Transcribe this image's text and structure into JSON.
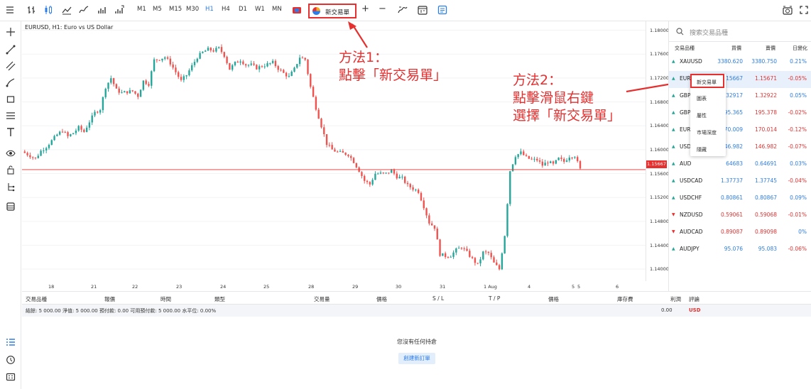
{
  "toolbar": {
    "timeframes": [
      "M1",
      "M5",
      "M15",
      "M30",
      "H1",
      "H4",
      "D1",
      "W1",
      "MN"
    ],
    "active_timeframe": "H1",
    "new_order_label": "新交易單",
    "plus_label": "+",
    "minus_label": "−"
  },
  "chart": {
    "title": "EURUSD, H1: Euro vs US Dollar",
    "current_price": "1.15667",
    "price_ticks": [
      "1.18000",
      "1.17600",
      "1.17200",
      "1.16800",
      "1.16400",
      "1.16000",
      "1.15600",
      "1.15200",
      "1.14800",
      "1.14400",
      "1.14000"
    ],
    "date_ticks": [
      "18",
      "21",
      "22",
      "23",
      "24",
      "25",
      "28",
      "29",
      "30",
      "31",
      "1 Aug",
      "4",
      "5",
      "5",
      "6"
    ],
    "colors": {
      "up": "#26a69a",
      "down": "#ef5350",
      "price_line": "#e5302f"
    }
  },
  "chart_data": {
    "type": "candlestick",
    "title": "EURUSD, H1: Euro vs US Dollar",
    "ylim": [
      1.138,
      1.1815
    ],
    "current_price": 1.15667,
    "x_labels": [
      "18",
      "21",
      "22",
      "23",
      "24",
      "25",
      "28",
      "29",
      "30",
      "31",
      "1 Aug",
      "4",
      "5",
      "5",
      "6"
    ],
    "close_path": [
      [
        0,
        1.1597
      ],
      [
        3,
        1.159
      ],
      [
        5,
        1.1585
      ],
      [
        7,
        1.1598
      ],
      [
        9,
        1.1605
      ],
      [
        11,
        1.1615
      ],
      [
        13,
        1.1625
      ],
      [
        15,
        1.1632
      ],
      [
        17,
        1.1622
      ],
      [
        19,
        1.1628
      ],
      [
        21,
        1.1637
      ],
      [
        23,
        1.163
      ],
      [
        25,
        1.1647
      ],
      [
        27,
        1.1662
      ],
      [
        29,
        1.1668
      ],
      [
        31,
        1.1705
      ],
      [
        33,
        1.172
      ],
      [
        35,
        1.17
      ],
      [
        37,
        1.1695
      ],
      [
        39,
        1.1697
      ],
      [
        41,
        1.1698
      ],
      [
        43,
        1.169
      ],
      [
        45,
        1.1715
      ],
      [
        47,
        1.171
      ],
      [
        49,
        1.175
      ],
      [
        51,
        1.1752
      ],
      [
        53,
        1.1755
      ],
      [
        55,
        1.1745
      ],
      [
        57,
        1.173
      ],
      [
        59,
        1.1715
      ],
      [
        61,
        1.1725
      ],
      [
        63,
        1.174
      ],
      [
        65,
        1.1755
      ],
      [
        67,
        1.1763
      ],
      [
        69,
        1.1768
      ],
      [
        71,
        1.1766
      ],
      [
        73,
        1.177
      ],
      [
        75,
        1.1758
      ],
      [
        77,
        1.1735
      ],
      [
        79,
        1.1745
      ],
      [
        81,
        1.175
      ],
      [
        83,
        1.1742
      ],
      [
        85,
        1.1742
      ],
      [
        87,
        1.1737
      ],
      [
        89,
        1.174
      ],
      [
        91,
        1.1743
      ],
      [
        93,
        1.1746
      ],
      [
        95,
        1.1736
      ],
      [
        97,
        1.1728
      ],
      [
        99,
        1.1722
      ],
      [
        101,
        1.1735
      ],
      [
        103,
        1.1755
      ],
      [
        105,
        1.1751
      ],
      [
        107,
        1.1705
      ],
      [
        109,
        1.167
      ],
      [
        111,
        1.164
      ],
      [
        113,
        1.161
      ],
      [
        115,
        1.16
      ],
      [
        117,
        1.1596
      ],
      [
        119,
        1.1594
      ],
      [
        121,
        1.1592
      ],
      [
        123,
        1.158
      ],
      [
        125,
        1.1565
      ],
      [
        127,
        1.1548
      ],
      [
        129,
        1.1542
      ],
      [
        131,
        1.156
      ],
      [
        133,
        1.156
      ],
      [
        135,
        1.156
      ],
      [
        137,
        1.1565
      ],
      [
        139,
        1.1555
      ],
      [
        141,
        1.1552
      ],
      [
        143,
        1.154
      ],
      [
        145,
        1.1535
      ],
      [
        147,
        1.153
      ],
      [
        149,
        1.1505
      ],
      [
        151,
        1.1478
      ],
      [
        153,
        1.147
      ],
      [
        155,
        1.1425
      ],
      [
        157,
        1.1422
      ],
      [
        159,
        1.1423
      ],
      [
        161,
        1.1432
      ],
      [
        163,
        1.1437
      ],
      [
        165,
        1.1428
      ],
      [
        167,
        1.1417
      ],
      [
        169,
        1.1407
      ],
      [
        171,
        1.1428
      ],
      [
        173,
        1.1427
      ],
      [
        175,
        1.141
      ],
      [
        177,
        1.14
      ],
      [
        179,
        1.1457
      ],
      [
        181,
        1.1565
      ],
      [
        183,
        1.159
      ],
      [
        185,
        1.1595
      ],
      [
        187,
        1.1587
      ],
      [
        189,
        1.1583
      ],
      [
        191,
        1.1583
      ],
      [
        193,
        1.1574
      ],
      [
        195,
        1.158
      ],
      [
        197,
        1.1575
      ],
      [
        199,
        1.1585
      ],
      [
        201,
        1.158
      ],
      [
        203,
        1.1589
      ],
      [
        205,
        1.159
      ],
      [
        207,
        1.1567
      ]
    ],
    "grid": true
  },
  "annotations": {
    "method1": [
      "方法1：",
      "點擊「新交易單」"
    ],
    "method2": [
      "方法2：",
      "點擊滑鼠右鍵",
      "選擇「新交易單」"
    ]
  },
  "watchlist": {
    "search_placeholder": "搜索交易品種",
    "headers": [
      "交易品種",
      "買價",
      "賣價",
      "日變化"
    ],
    "rows": [
      {
        "dir": "up",
        "symbol": "XAUUSD",
        "bid": "3380.620",
        "ask": "3380.750",
        "change": "0.21%",
        "bid_dir": "up",
        "ask_dir": "up",
        "chg_dir": "up"
      },
      {
        "dir": "up",
        "symbol": "EURUSD",
        "bid": "1.15667",
        "ask": "1.15671",
        "change": "-0.05%",
        "bid_dir": "up",
        "ask_dir": "down",
        "chg_dir": "down"
      },
      {
        "dir": "up",
        "symbol": "GBPUSD",
        "bid": "1.32917",
        "ask": "1.32922",
        "change": "0.05%",
        "bid_dir": "up",
        "ask_dir": "down",
        "chg_dir": "up"
      },
      {
        "dir": "up",
        "symbol": "GBPJPY",
        "bid": "195.365",
        "ask": "195.378",
        "change": "-0.02%",
        "bid_dir": "up",
        "ask_dir": "down",
        "chg_dir": "down"
      },
      {
        "dir": "up",
        "symbol": "EURJPY",
        "bid": "170.009",
        "ask": "170.014",
        "change": "-0.12%",
        "bid_dir": "up",
        "ask_dir": "down",
        "chg_dir": "down"
      },
      {
        "dir": "up",
        "symbol": "USDJPY",
        "bid": "146.982",
        "ask": "146.982",
        "change": "-0.07%",
        "bid_dir": "up",
        "ask_dir": "down",
        "chg_dir": "down"
      },
      {
        "dir": "up",
        "symbol": "AUDUSD",
        "bid": "0.64683",
        "ask": "0.64691",
        "change": "0.03%",
        "bid_dir": "up",
        "ask_dir": "up",
        "chg_dir": "up"
      },
      {
        "dir": "up",
        "symbol": "USDCAD",
        "bid": "1.37737",
        "ask": "1.37745",
        "change": "-0.04%",
        "bid_dir": "up",
        "ask_dir": "up",
        "chg_dir": "down"
      },
      {
        "dir": "up",
        "symbol": "USDCHF",
        "bid": "0.80861",
        "ask": "0.80867",
        "change": "0.09%",
        "bid_dir": "up",
        "ask_dir": "up",
        "chg_dir": "up"
      },
      {
        "dir": "down",
        "symbol": "NZDUSD",
        "bid": "0.59061",
        "ask": "0.59068",
        "change": "-0.01%",
        "bid_dir": "down",
        "ask_dir": "down",
        "chg_dir": "down"
      },
      {
        "dir": "down",
        "symbol": "AUDCAD",
        "bid": "0.89087",
        "ask": "0.89098",
        "change": "0%",
        "bid_dir": "down",
        "ask_dir": "down",
        "chg_dir": "up"
      },
      {
        "dir": "up",
        "symbol": "AUDJPY",
        "bid": "95.076",
        "ask": "95.083",
        "change": "-0.06%",
        "bid_dir": "up",
        "ask_dir": "up",
        "chg_dir": "down"
      }
    ],
    "visible_symbols": [
      "XAUUSD",
      "EUR",
      "GBP",
      "GBP",
      "EUR",
      "USD",
      "AUD",
      "USDCAD",
      "USDCHF",
      "NZDUSD",
      "AUDCAD",
      "AUDJPY"
    ],
    "visible_bids": [
      "3380.620",
      "15667",
      "32917",
      "95.365",
      "70.009",
      "46.982",
      "64683",
      "1.37737",
      "0.80861",
      "0.59061",
      "0.89087",
      "95.076"
    ]
  },
  "context_menu": {
    "items": [
      "新交易單",
      "圖表",
      "屬性",
      "市場深度",
      "隱藏"
    ]
  },
  "bottom": {
    "headers": [
      "交易品種",
      "報價",
      "時間",
      "類型",
      "交易量",
      "價格",
      "S / L",
      "T / P",
      "價格",
      "庫存費",
      "利潤",
      "評論"
    ],
    "summary": "結餘: 5 000.00   淨值: 5 000.00   預付款: 0.00   可用預付款: 5 000.00   水平位: 0.00%",
    "profit_value": "0.00",
    "currency": "USD",
    "no_positions": "您沒有任何持倉",
    "create_order": "創建新訂單"
  }
}
